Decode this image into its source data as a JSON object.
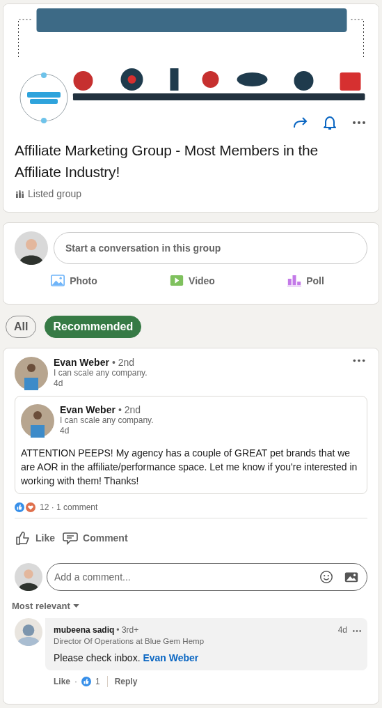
{
  "group": {
    "title": "Affiliate Marketing Group - Most Members in the Affiliate Industry!",
    "privacy": "Listed group"
  },
  "composer": {
    "placeholder": "Start a conversation in this group",
    "actions": [
      {
        "label": "Photo"
      },
      {
        "kind": "video",
        "label": "Video"
      },
      {
        "kind": "poll",
        "label": "Poll"
      }
    ]
  },
  "filters": [
    {
      "label": "All",
      "selected": false
    },
    {
      "label": "Recommended",
      "selected": true
    }
  ],
  "post": {
    "author": "Evan Weber",
    "degree": "• 2nd",
    "headline": "I can scale any company.",
    "time": "4d",
    "shared": {
      "author": "Evan Weber",
      "degree": "• 2nd",
      "headline": "I can scale any company.",
      "time": "4d",
      "text": "ATTENTION PEEPS! My agency has a couple of GREAT pet brands that we are AOR in the affiliate/performance space. Let me know if you're interested in working with them! Thanks!"
    },
    "stats": "12 · 1 comment",
    "actions": [
      {
        "kind": "like",
        "label": "Like"
      },
      {
        "kind": "comment",
        "label": "Comment"
      }
    ]
  },
  "comment_box": {
    "placeholder": "Add a comment..."
  },
  "sort": "Most relevant",
  "comments": [
    {
      "author": "mubeena sadiq",
      "degree": "• 3rd+",
      "headline": "Director Of Operations at Blue Gem Hemp",
      "time": "4d",
      "text": "Please check inbox.",
      "mention": "Evan Weber",
      "like": "Like",
      "separator": "·",
      "likes": "1",
      "reply": "Reply"
    }
  ]
}
